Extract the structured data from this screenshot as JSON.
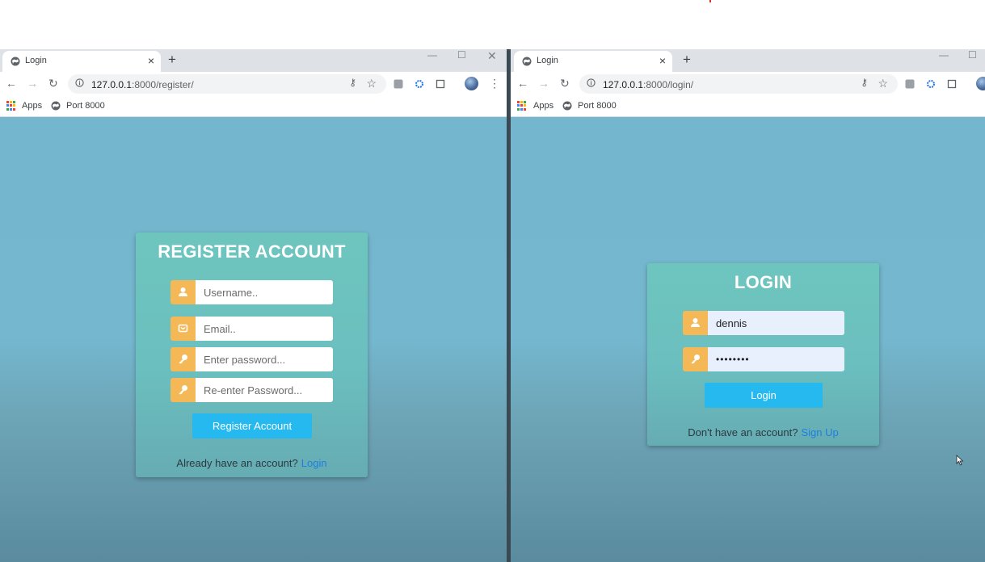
{
  "left_window": {
    "tab_title": "Login",
    "url_host": "127.0.0.1",
    "url_rest": ":8000/register/",
    "bookmarks": [
      "Apps",
      "Port 8000"
    ],
    "card": {
      "title": "REGISTER ACCOUNT",
      "username_placeholder": "Username..",
      "email_placeholder": "Email..",
      "password_placeholder": "Enter password...",
      "password2_placeholder": "Re-enter Password...",
      "submit_label": "Register Account",
      "footer_text": "Already have an account?",
      "footer_link": "Login"
    }
  },
  "right_window": {
    "tab_title": "Login",
    "url_host": "127.0.0.1",
    "url_rest": ":8000/login/",
    "bookmarks": [
      "Apps",
      "Port 8000"
    ],
    "card": {
      "title": "LOGIN",
      "username_value": "dennis",
      "password_value": "••••••••",
      "submit_label": "Login",
      "footer_text": "Don't have an account?",
      "footer_link": "Sign Up"
    }
  },
  "colors": {
    "page_background": "#73b6cd",
    "card": "#6ec5be",
    "icon_box": "#f5b856",
    "button": "#26b9f0",
    "link": "#1e7fe0"
  },
  "icons": [
    "globe-icon",
    "close-icon",
    "plus-icon",
    "back-arrow-icon",
    "forward-arrow-icon",
    "reload-icon",
    "info-icon",
    "key-icon",
    "star-icon",
    "apps-grid-icon",
    "user-icon",
    "mail-icon",
    "password-key-icon",
    "cursor-icon"
  ]
}
